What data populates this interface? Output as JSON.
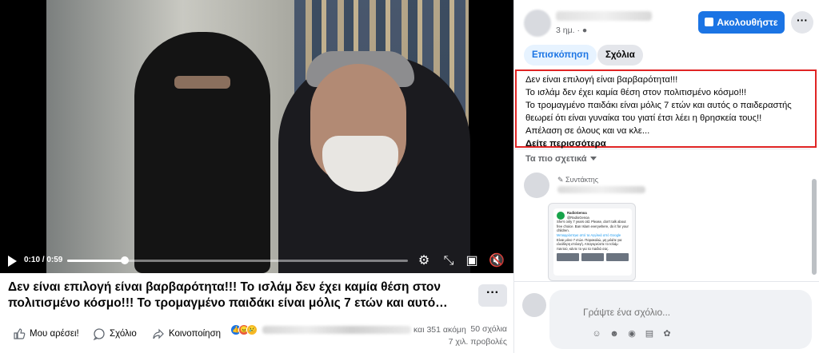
{
  "video": {
    "time_display": "0:10 / 0:59",
    "progress": 0.17
  },
  "post": {
    "title": "Δεν είναι επιλογή είναι βαρβαρότητα!!! Το ισλάμ δεν έχει καμία θέση στον πολιτισμένο κόσμο!!! Το τρομαγμένο παιδάκι είναι μόλις 7 ετών και αυτό…",
    "more_label": "···"
  },
  "actions": {
    "like": "Μου αρέσει!",
    "comment": "Σχόλιο",
    "share": "Κοινοποίηση",
    "reactions_suffix": "και 351 ακόμη",
    "comments_count": "50 σχόλια",
    "views_count": "7 χιλ. προβολές"
  },
  "sidebar": {
    "time": "3 ημ. · ",
    "follow_label": "Ακολουθήστε",
    "options_label": "···",
    "tabs": [
      {
        "label": "Επισκόπηση"
      },
      {
        "label": "Σχόλια"
      }
    ],
    "text_lines": [
      "Δεν είναι επιλογή είναι βαρβαρότητα!!!",
      "Το ισλάμ δεν έχει καμία θέση στον πολιτισμένο κόσμο!!!",
      "Το τρομαγμένο παιδάκι είναι μόλις 7 ετών και αυτός ο παιδεραστής",
      "θεωρεί ότι είναι γυναίκα του γιατί έτσι λέει η θρησκεία τους!!",
      "Απέλαση σε όλους και να κλε..."
    ],
    "see_more": "Δείτε περισσότερα",
    "relevant_label": "Τα πιο σχετικά",
    "comment_badge": "Συντάκτης",
    "tweet": {
      "account": "RadioGenoa",
      "handle": "@RadioGenoa",
      "text_en": "She's only 7 years old. Please, don't talk about free choice. Ban Islam everywhere, do it for your children.",
      "translate_link": "Μεταφράστηκε από τα Αγγλικά από Google",
      "text_gr": "Είναι μόνο 7 ετών. Παρακαλώ, μη μιλάτε για ελεύθερη επιλογή. Απαγορεύστε το Ισλάμ παντού, κάντε το για τα παιδιά σας."
    },
    "composer_placeholder": "Γράψτε ένα σχόλιο..."
  }
}
